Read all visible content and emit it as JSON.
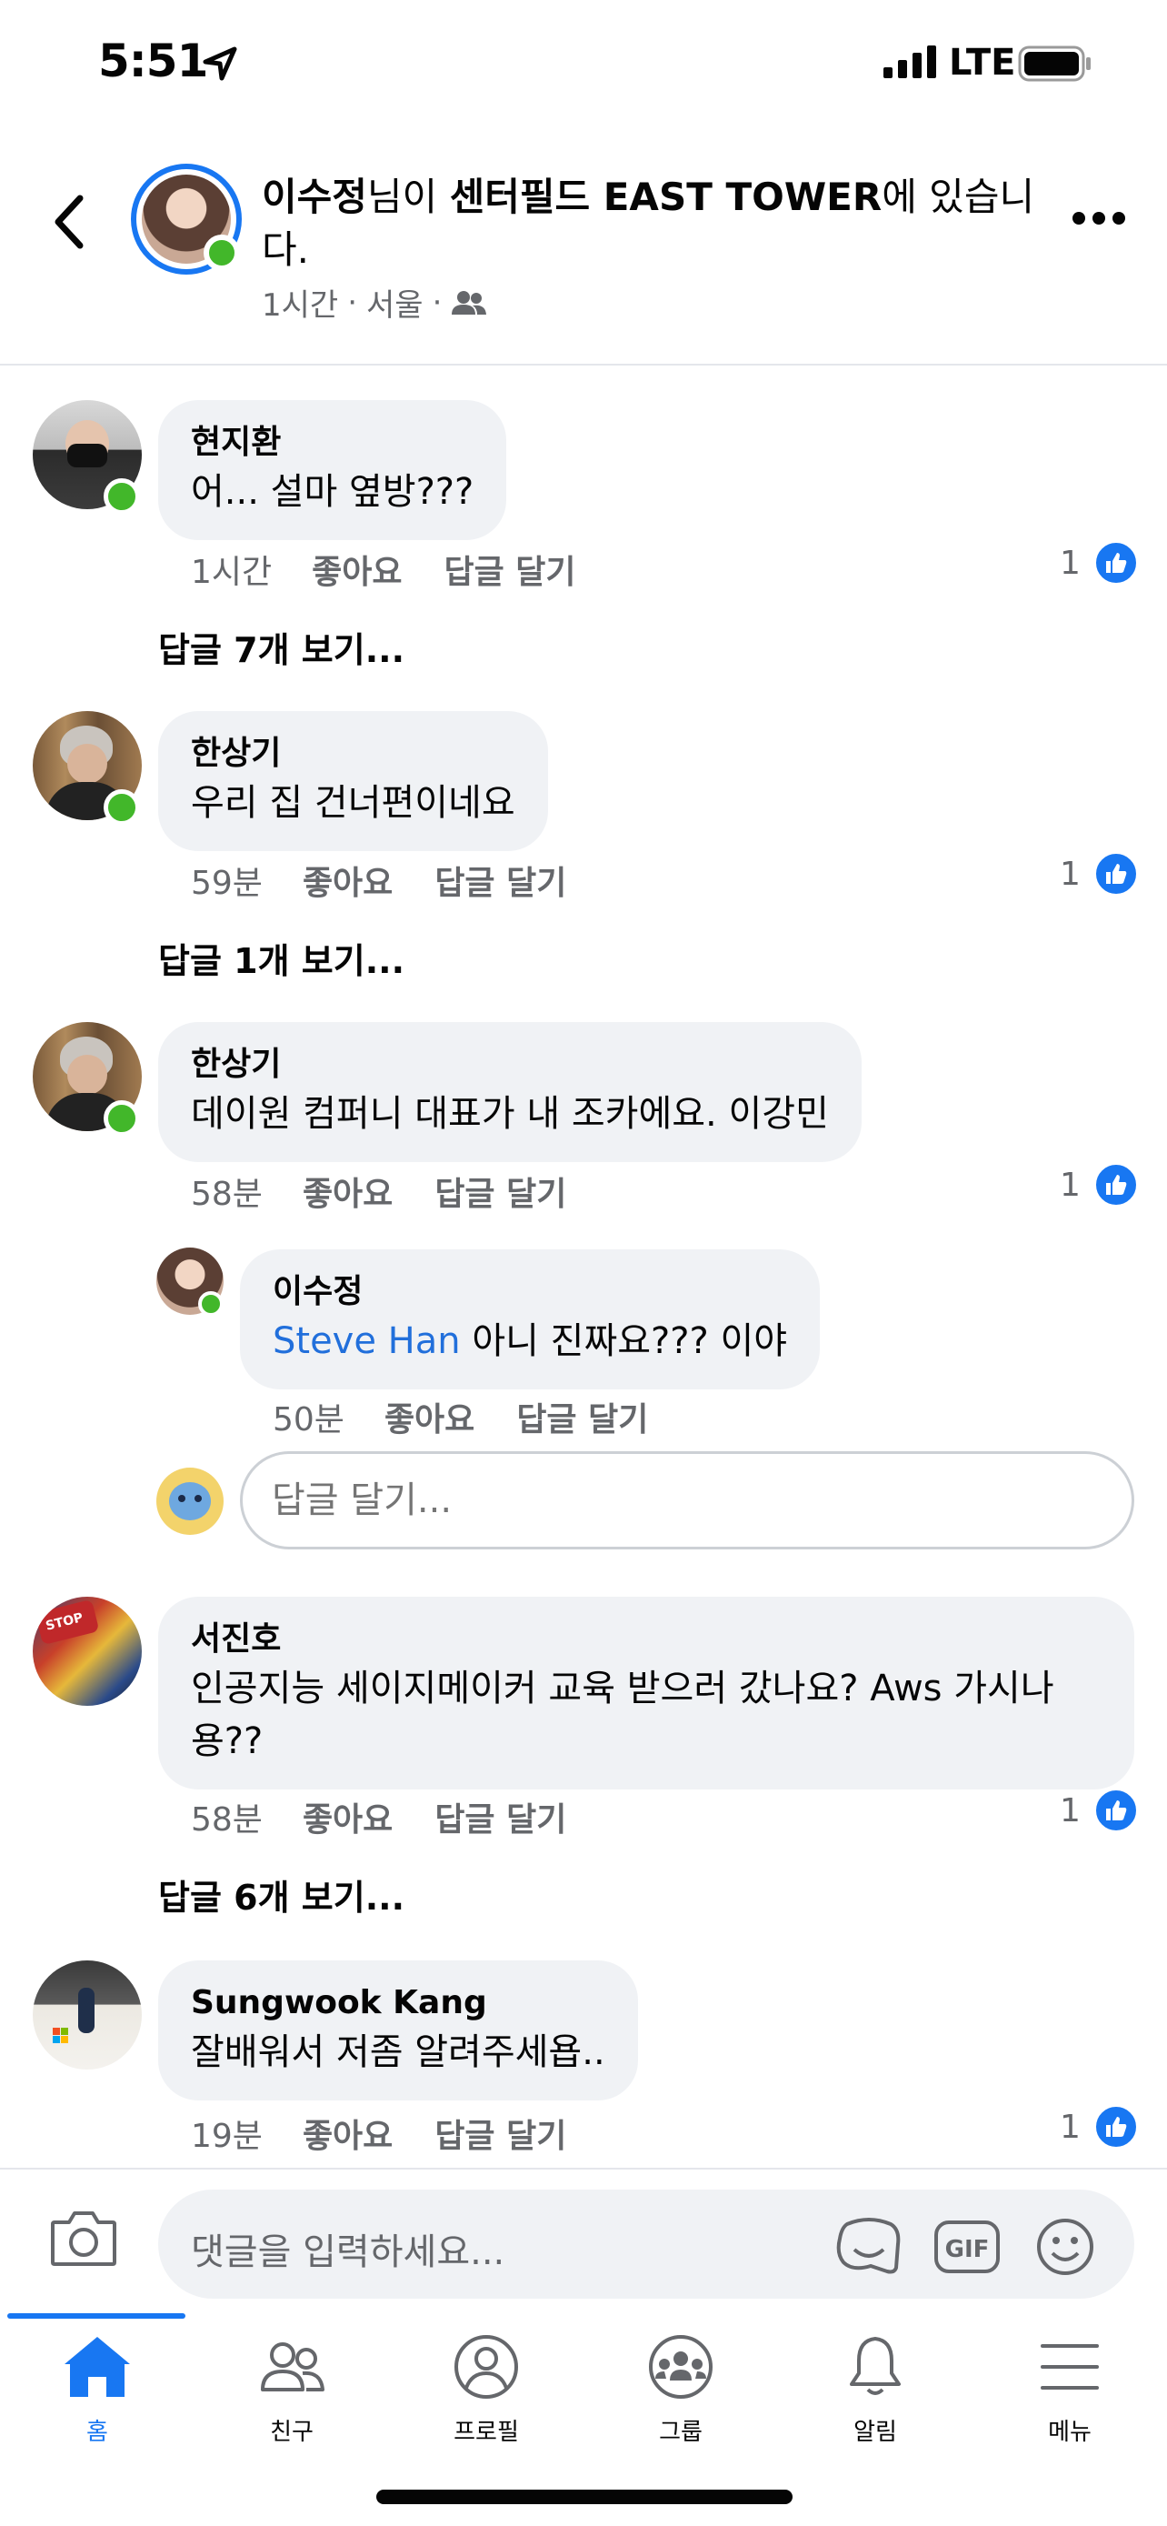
{
  "status_bar": {
    "time": "5:51",
    "network": "LTE"
  },
  "header": {
    "title_name": "이수정",
    "title_mid": "님이 ",
    "title_place": "센터필드 EAST TOWER",
    "title_end": "에 있습니다.",
    "meta_time": "1시간",
    "meta_sep": "·",
    "meta_location": "서울",
    "meta_sep2": "·"
  },
  "comments": [
    {
      "name": "현지환",
      "text": "어... 설마 옆방???",
      "time": "1시간",
      "like": "좋아요",
      "reply": "답글 달기",
      "likes": "1",
      "view_replies": "답글 7개 보기..."
    },
    {
      "name": "한상기",
      "text": "우리 집 건너편이네요",
      "time": "59분",
      "like": "좋아요",
      "reply": "답글 달기",
      "likes": "1",
      "view_replies": "답글 1개 보기..."
    },
    {
      "name": "한상기",
      "text": "데이원 컴퍼니 대표가 내 조카에요. 이강민",
      "time": "58분",
      "like": "좋아요",
      "reply": "답글 달기",
      "likes": "1"
    },
    {
      "name": "서진호",
      "text": "인공지능 세이지메이커 교육 받으러 갔나요? Aws 가시나용??",
      "time": "58분",
      "like": "좋아요",
      "reply": "답글 달기",
      "likes": "1",
      "view_replies": "답글 6개 보기..."
    },
    {
      "name": "Sungwook Kang",
      "text": "잘배워서 저좀 알려주세욥..",
      "time": "19분",
      "like": "좋아요",
      "reply": "답글 달기",
      "likes": "1"
    }
  ],
  "nested_reply": {
    "name": "이수정",
    "mention": "Steve Han",
    "text": " 아니 진짜요??? 이야",
    "time": "50분",
    "like": "좋아요",
    "reply": "답글 달기"
  },
  "reply_input": {
    "placeholder": "답글 달기..."
  },
  "composer": {
    "placeholder": "댓글을 입력하세요..."
  },
  "tabs": [
    {
      "label": "홈",
      "icon": "home-icon",
      "active": true
    },
    {
      "label": "친구",
      "icon": "friends-icon"
    },
    {
      "label": "프로필",
      "icon": "profile-icon"
    },
    {
      "label": "그룹",
      "icon": "groups-icon"
    },
    {
      "label": "알림",
      "icon": "bell-icon"
    },
    {
      "label": "메뉴",
      "icon": "menu-icon"
    }
  ],
  "colors": {
    "accent": "#1877f2",
    "online": "#42b72a",
    "bubble": "#f0f2f5",
    "muted": "#65676b",
    "mention": "#216fdb"
  }
}
